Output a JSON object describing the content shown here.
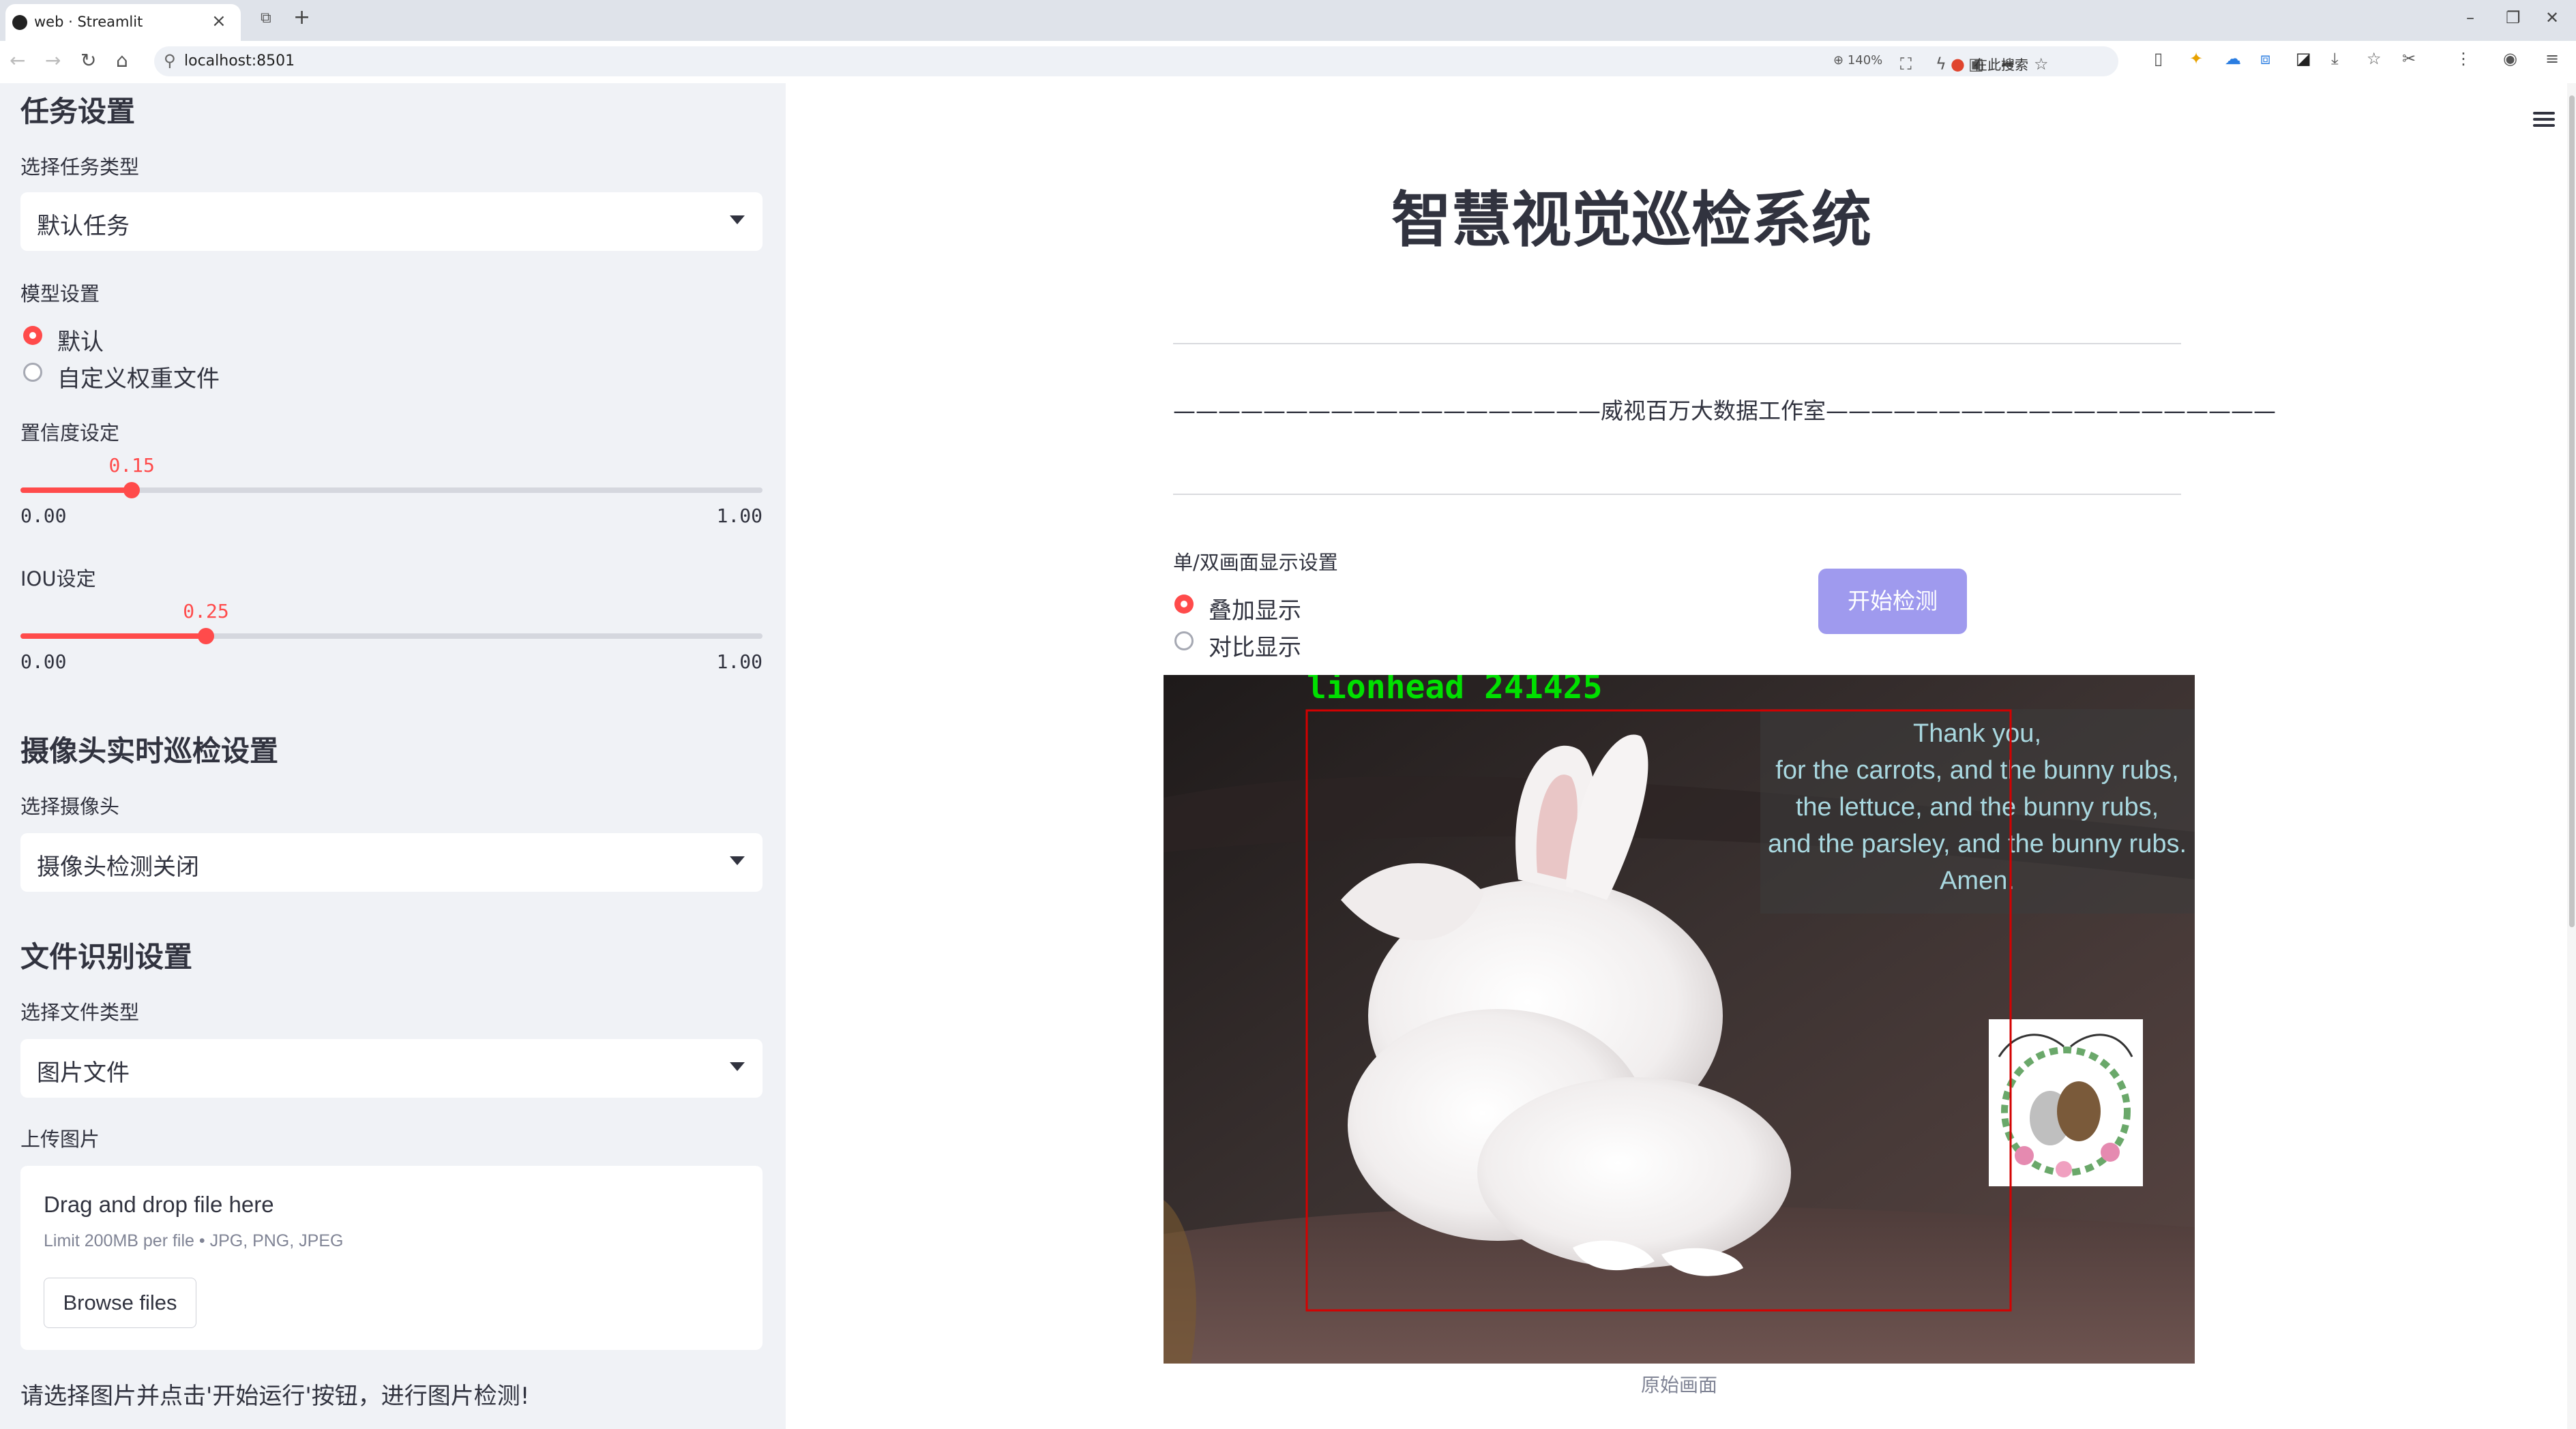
{
  "browser": {
    "tab_title": "web · Streamlit",
    "url": "localhost:8501",
    "zoom": "140%",
    "search_placeholder": "在此搜索"
  },
  "sidebar": {
    "task_section_title": "任务设置",
    "task_type_label": "选择任务类型",
    "task_type_value": "默认任务",
    "model_section_label": "模型设置",
    "model_options": [
      "默认",
      "自定义权重文件"
    ],
    "model_selected": "默认",
    "confidence": {
      "label": "置信度设定",
      "value": "0.15",
      "min": "0.00",
      "max": "1.00",
      "fraction": 0.15
    },
    "iou": {
      "label": "IOU设定",
      "value": "0.25",
      "min": "0.00",
      "max": "1.00",
      "fraction": 0.25
    },
    "camera_section_title": "摄像头实时巡检设置",
    "camera_label": "选择摄像头",
    "camera_value": "摄像头检测关闭",
    "file_section_title": "文件识别设置",
    "file_type_label": "选择文件类型",
    "file_type_value": "图片文件",
    "upload_label": "上传图片",
    "uploader_title": "Drag and drop file here",
    "uploader_limit": "Limit 200MB per file • JPG, PNG, JPEG",
    "browse_button": "Browse files",
    "hint": "请选择图片并点击'开始运行'按钮，进行图片检测!"
  },
  "main": {
    "title": "智慧视觉巡检系统",
    "studio_line": "———————————————————威视百万大数据工作室————————————————————",
    "display_mode_label": "单/双画面显示设置",
    "display_options": [
      "叠加显示",
      "对比显示"
    ],
    "display_selected": "叠加显示",
    "start_button": "开始检测",
    "detection_label": "lionhead 241425",
    "image_overlay_lines": [
      "Thank you,",
      "for the carrots, and the bunny rubs,",
      "the lettuce, and the bunny rubs,",
      "and the parsley, and the bunny rubs.",
      "Amen."
    ],
    "image_caption": "原始画面"
  },
  "colors": {
    "accent": "#ff4b4b",
    "sidebar_bg": "#f0f2f6",
    "button_bg": "#9f9aee",
    "detection_box": "#d40000",
    "detection_text": "#00e000"
  }
}
